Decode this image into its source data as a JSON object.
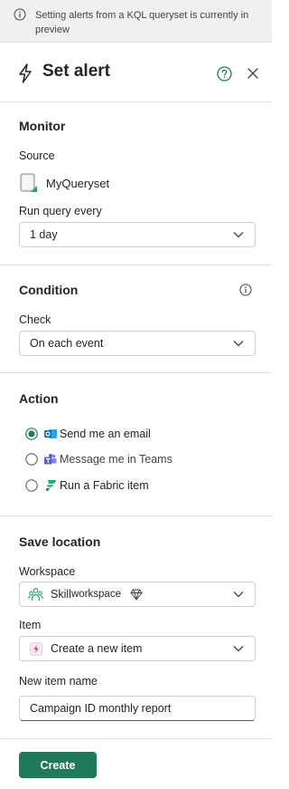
{
  "banner": {
    "text": "Setting alerts from a KQL queryset is currently in preview"
  },
  "header": {
    "title": "Set alert"
  },
  "monitor": {
    "title": "Monitor",
    "source_label": "Source",
    "source_value": "MyQueryset",
    "run_label": "Run query every",
    "run_value": "1 day"
  },
  "condition": {
    "title": "Condition",
    "check_label": "Check",
    "check_value": "On each event"
  },
  "action": {
    "title": "Action",
    "options": [
      {
        "label": "Send me an email",
        "selected": true
      },
      {
        "label": "Message me in Teams",
        "selected": false
      },
      {
        "label": "Run a Fabric item",
        "selected": false
      }
    ]
  },
  "save_location": {
    "title": "Save location",
    "workspace_label": "Workspace",
    "workspace_name": "Skill",
    "workspace_suffix": "workspace",
    "item_label": "Item",
    "item_value": "Create a new item",
    "new_item_label": "New item name",
    "new_item_value": "Campaign ID monthly report"
  },
  "footer": {
    "create_label": "Create"
  },
  "colors": {
    "accent": "#1f7a5a",
    "outlook": "#0f6cbd",
    "teams": "#5b5fc7"
  }
}
